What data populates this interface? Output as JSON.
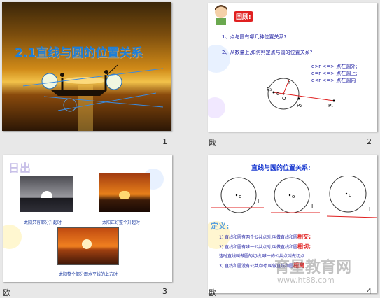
{
  "slides": [
    {
      "number": "1",
      "title": "2.1直线与圆的位置关系"
    },
    {
      "number": "2",
      "heading": "回顾:",
      "q1": "1、点与圆有哪几种位置关系?",
      "q2": "2、从数量上,如何判定点与圆的位置关系?",
      "rules": [
        "d>r <=> 点在圆外;",
        "d=r <=> 点在圆上;",
        "d<r <=> 点在圆内"
      ],
      "labels": {
        "p1": "P₁",
        "p2": "P₂",
        "p3": "P₃",
        "o": "O",
        "r": "r",
        "d": "d"
      },
      "corner": "欧"
    },
    {
      "number": "3",
      "heading": "日出",
      "captions": [
        "太阳只有部分升起时",
        "太阳正好整个升起时",
        "太阳整个部分跟水平线的上方时"
      ],
      "corner": "欧"
    },
    {
      "number": "4",
      "heading": "直线与圆的位置关系:",
      "labels": {
        "o": "o",
        "l": "l"
      },
      "def_title": "定义:",
      "defs": [
        {
          "prefix": "1)",
          "text": "直线和圆有两个公共点时,叫做直线和圆",
          "term": "相交;"
        },
        {
          "prefix": "2)",
          "text": "直线和圆有唯一公共点时,叫做直线和圆",
          "term": "相切;"
        },
        {
          "prefix": "",
          "text": "这时直线叫做圆的切线,唯一的公共点叫做切点",
          "term": ""
        },
        {
          "prefix": "3)",
          "text": "直线和圆没有公共点时,叫做直线和圆",
          "term": "相离"
        }
      ],
      "corner": "欧"
    }
  ],
  "watermark": {
    "main": "育星教育网",
    "url": "www.ht88.com"
  }
}
